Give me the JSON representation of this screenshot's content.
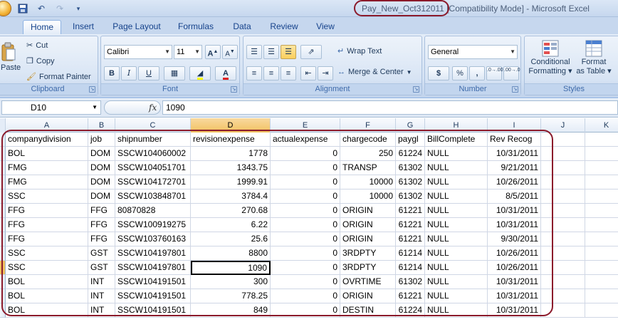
{
  "window": {
    "file_name": "Pay_New_Oct312011",
    "title_rest": " [Compatibility Mode] - Microsoft Excel"
  },
  "qat": {
    "save_icon": "save-icon",
    "undo_icon": "undo-icon",
    "redo_icon": "redo-icon"
  },
  "tabs": [
    "Home",
    "Insert",
    "Page Layout",
    "Formulas",
    "Data",
    "Review",
    "View"
  ],
  "ribbon": {
    "clipboard": {
      "label": "Clipboard",
      "paste": "Paste",
      "cut": "Cut",
      "copy": "Copy",
      "format_painter": "Format Painter"
    },
    "font": {
      "label": "Font",
      "font_name": "Calibri",
      "font_size": "11",
      "bold": "B",
      "italic": "I",
      "underline": "U",
      "grow": "A",
      "shrink": "A"
    },
    "alignment": {
      "label": "Alignment",
      "wrap_text": "Wrap Text",
      "merge_center": "Merge & Center"
    },
    "number": {
      "label": "Number",
      "format": "General",
      "currency": "$",
      "percent": "%",
      "comma": ",",
      "inc_dec": ".0→.00",
      "dec_dec": ".00→.0"
    },
    "styles": {
      "label": "Styles",
      "conditional": "Conditional",
      "conditional2": "Formatting",
      "format_as": "Format",
      "format_as2": "as Table"
    }
  },
  "formula_bar": {
    "name_box": "D10",
    "fx": "fx",
    "value": "1090"
  },
  "grid": {
    "columns": [
      "A",
      "B",
      "C",
      "D",
      "E",
      "F",
      "G",
      "H",
      "I",
      "J",
      "K"
    ],
    "rows": [
      [
        "companydivision",
        "job",
        "shipnumber",
        "revisionexpense",
        "actualexpense",
        "chargecode",
        "paygl",
        "BillComplete",
        "Rev Recog"
      ],
      [
        "BOL",
        "DOM",
        "SSCW104060002",
        "1778",
        "0",
        "250",
        "61224",
        "NULL",
        "10/31/2011"
      ],
      [
        "FMG",
        "DOM",
        "SSCW104051701",
        "1343.75",
        "0",
        "TRANSP",
        "61302",
        "NULL",
        "9/21/2011"
      ],
      [
        "FMG",
        "DOM",
        "SSCW104172701",
        "1999.91",
        "0",
        "10000",
        "61302",
        "NULL",
        "10/26/2011"
      ],
      [
        "SSC",
        "DOM",
        "SSCW103848701",
        "3784.4",
        "0",
        "10000",
        "61302",
        "NULL",
        "8/5/2011"
      ],
      [
        "FFG",
        "FFG",
        "80870828",
        "270.68",
        "0",
        "ORIGIN",
        "61221",
        "NULL",
        "10/31/2011"
      ],
      [
        "FFG",
        "FFG",
        "SSCW100919275",
        "6.22",
        "0",
        "ORIGIN",
        "61221",
        "NULL",
        "10/31/2011"
      ],
      [
        "FFG",
        "FFG",
        "SSCW103760163",
        "25.6",
        "0",
        "ORIGIN",
        "61221",
        "NULL",
        "9/30/2011"
      ],
      [
        "SSC",
        "GST",
        "SSCW104197801",
        "8800",
        "0",
        "3RDPTY",
        "61214",
        "NULL",
        "10/26/2011"
      ],
      [
        "SSC",
        "GST",
        "SSCW104197801",
        "1090",
        "0",
        "3RDPTY",
        "61214",
        "NULL",
        "10/26/2011"
      ],
      [
        "BOL",
        "INT",
        "SSCW104191501",
        "300",
        "0",
        "OVRTIME",
        "61302",
        "NULL",
        "10/31/2011"
      ],
      [
        "BOL",
        "INT",
        "SSCW104191501",
        "778.25",
        "0",
        "ORIGIN",
        "61221",
        "NULL",
        "10/31/2011"
      ],
      [
        "BOL",
        "INT",
        "SSCW104191501",
        "849",
        "0",
        "DESTIN",
        "61224",
        "NULL",
        "10/31/2011"
      ]
    ]
  }
}
